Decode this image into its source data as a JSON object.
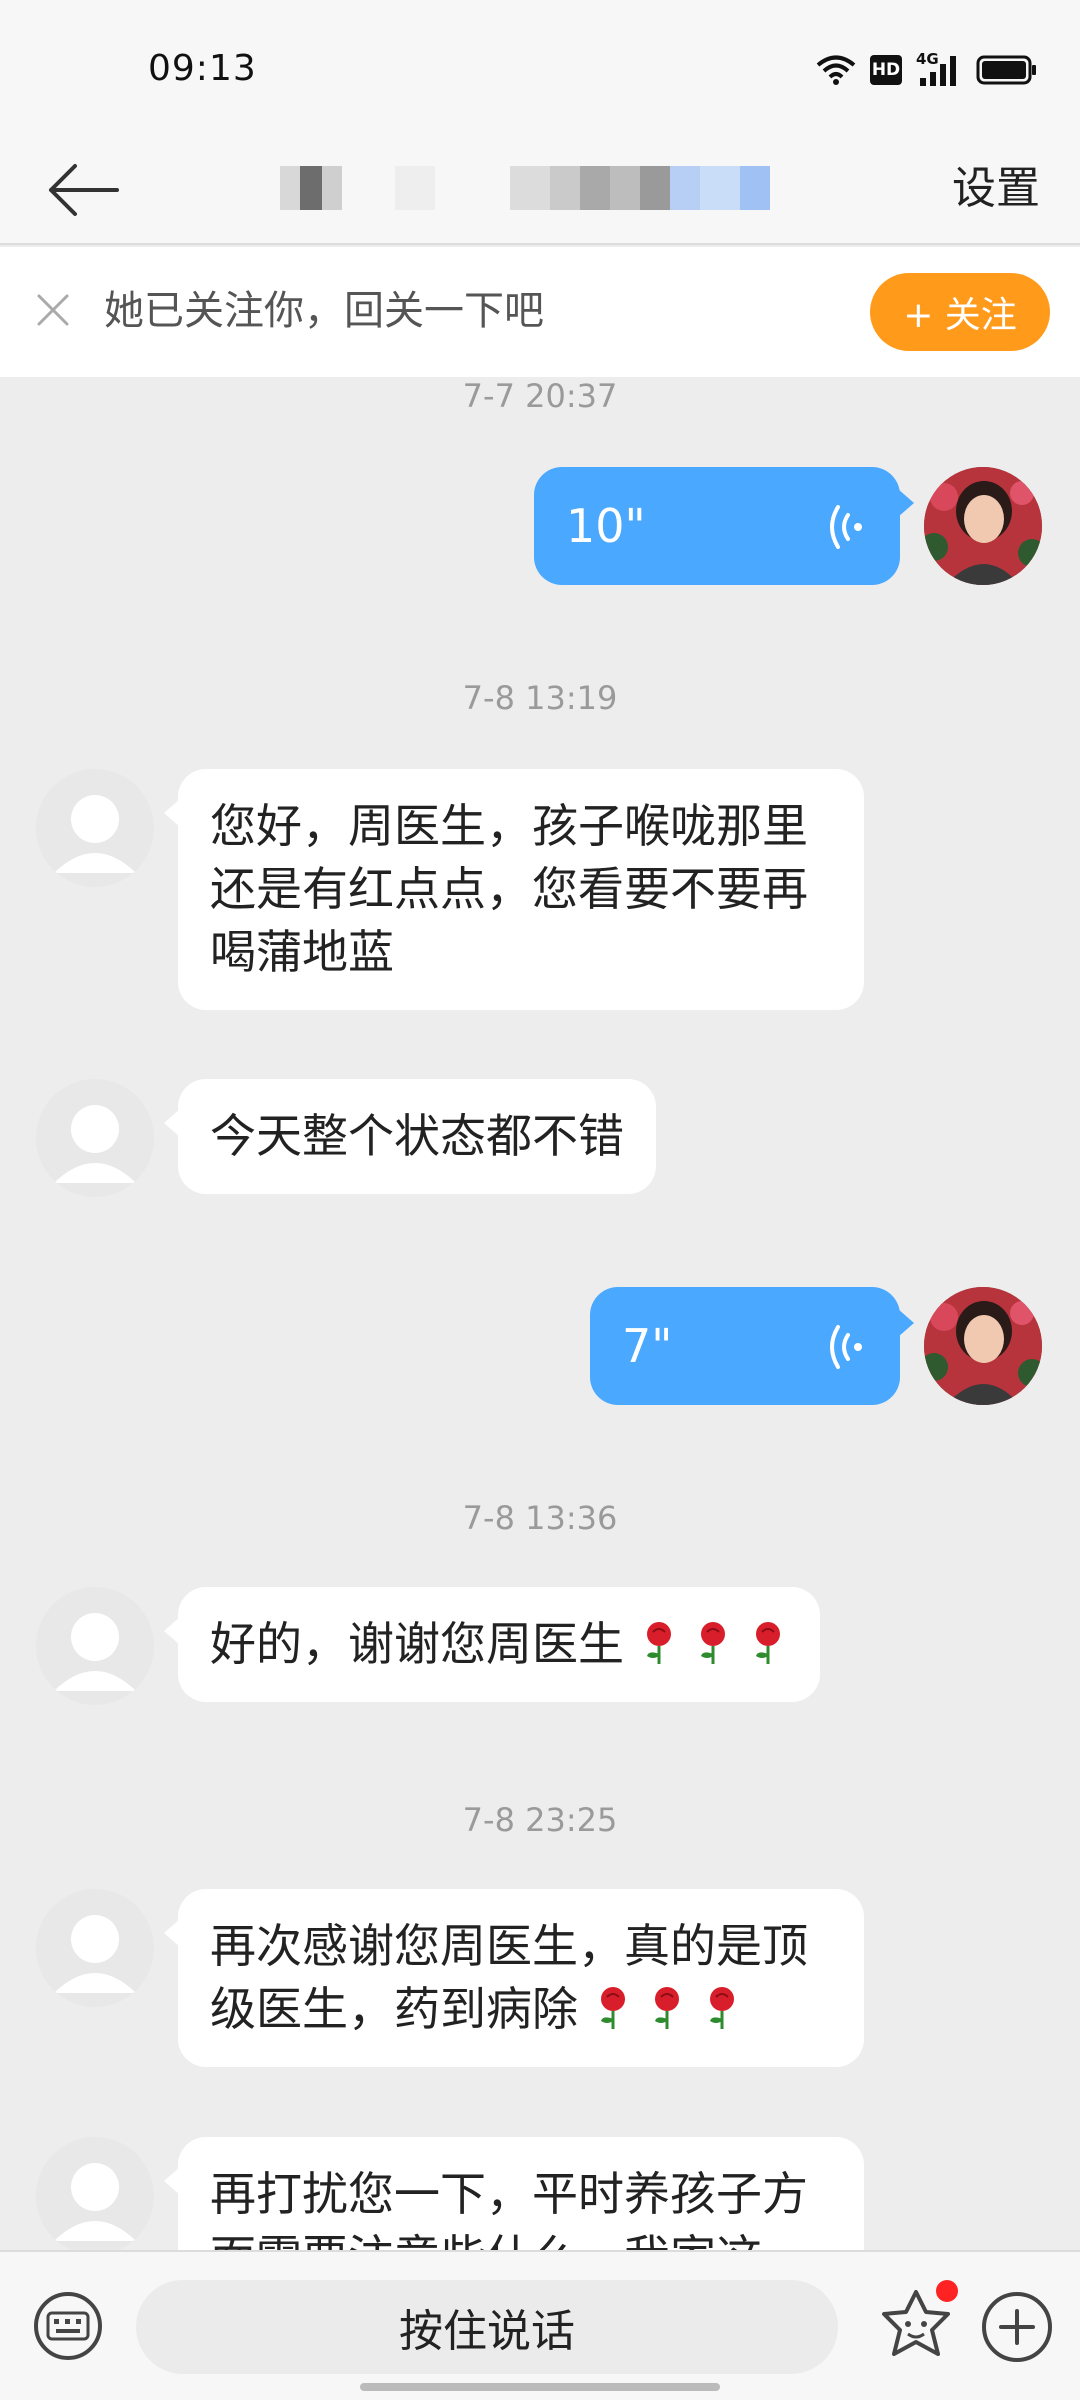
{
  "status_bar": {
    "time": "09:13",
    "hd_label": "HD",
    "network_label": "4G",
    "icons": [
      "wifi-icon",
      "hd-icon",
      "signal-4g-icon",
      "battery-icon"
    ]
  },
  "header": {
    "back_icon": "back-arrow-icon",
    "settings_label": "设置"
  },
  "follow_banner": {
    "close_icon": "close-icon",
    "text": "她已关注你，回关一下吧",
    "button_label": "+ 关注",
    "button_color": "#ff9a1b"
  },
  "messages": [
    {
      "kind": "timestamp",
      "text": "7-7 20:37"
    },
    {
      "kind": "voice",
      "side": "right",
      "duration": "10\""
    },
    {
      "kind": "timestamp",
      "text": "7-8 13:19"
    },
    {
      "kind": "text",
      "side": "left",
      "lines": [
        "您好，周医生，孩子喉咙那里",
        "还是有红点点，您看要不要再",
        "喝蒲地蓝"
      ]
    },
    {
      "kind": "text",
      "side": "left",
      "lines": [
        "今天整个状态都不错"
      ]
    },
    {
      "kind": "voice",
      "side": "right",
      "duration": "7\""
    },
    {
      "kind": "timestamp",
      "text": "7-8 13:36"
    },
    {
      "kind": "text",
      "side": "left",
      "lines": [
        "好的，谢谢您周医生"
      ],
      "emoji": "rose",
      "emoji_count": 3
    },
    {
      "kind": "timestamp",
      "text": "7-8 23:25"
    },
    {
      "kind": "text",
      "side": "left",
      "lines": [
        "再次感谢您周医生，真的是顶",
        "级医生，药到病除"
      ],
      "emoji": "rose",
      "emoji_count": 3
    },
    {
      "kind": "text",
      "side": "left",
      "lines": [
        "再打扰您一下，平时养孩子方",
        "面需要注意些什么，我家这"
      ]
    }
  ],
  "bottom_bar": {
    "keyboard_icon": "keyboard-icon",
    "hold_to_talk_label": "按住说话",
    "sticker_icon": "sticker-icon",
    "plus_icon": "plus-icon"
  },
  "colors": {
    "voice_bubble": "#4aa8ff",
    "chat_background": "#ededed",
    "notification_dot": "#ff2222"
  }
}
